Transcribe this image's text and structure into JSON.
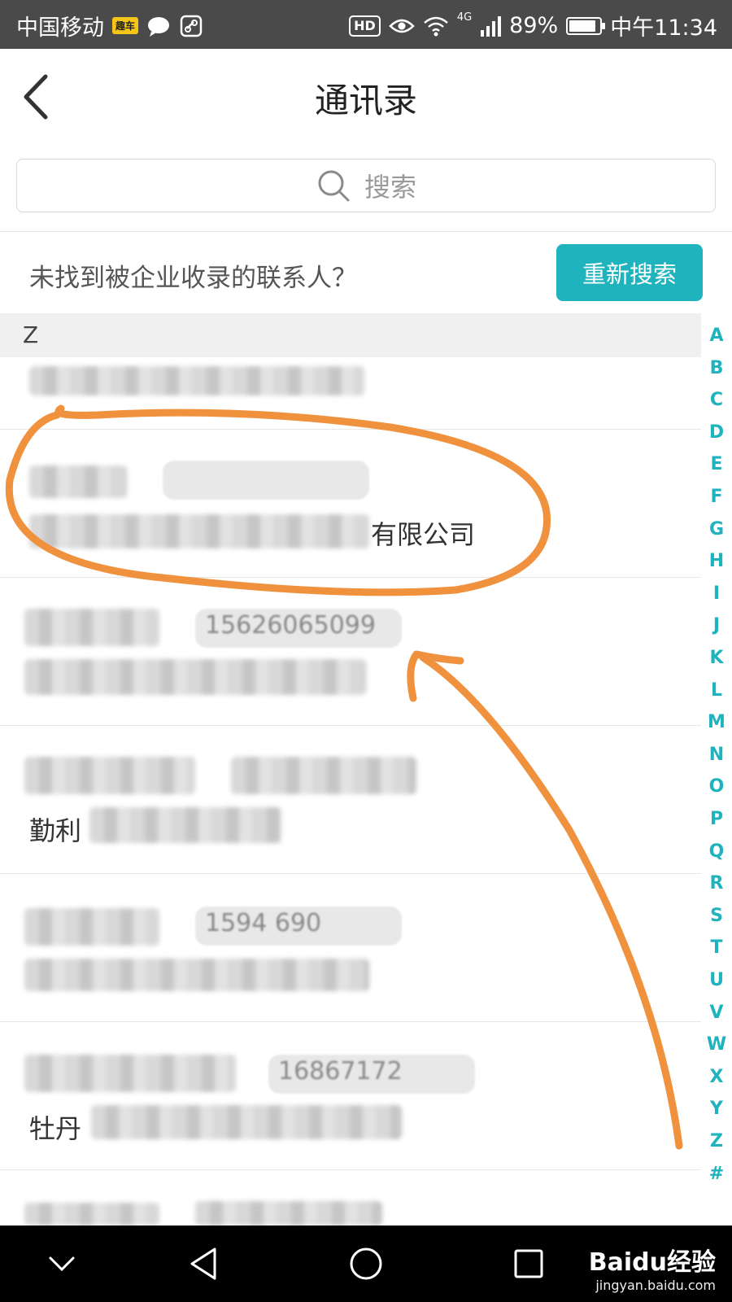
{
  "status_bar": {
    "carrier": "中国移动",
    "app_chip": "趣车",
    "network": "4G",
    "battery_percent": 89,
    "battery_text": "89%",
    "time": "中午11:34",
    "hd_label": "HD"
  },
  "header": {
    "title": "通讯录"
  },
  "search": {
    "placeholder": "搜索"
  },
  "notice": {
    "text": "未找到被企业收录的联系人？",
    "button_label": "重新搜索"
  },
  "section": {
    "letter": "Z"
  },
  "contacts": [
    {
      "name": "",
      "phone": "",
      "company": ""
    },
    {
      "name": "",
      "phone": "",
      "company": "有限公司"
    },
    {
      "name": "",
      "phone": "15626065099",
      "company": ""
    },
    {
      "name": "",
      "phone": "",
      "company": "勤利"
    },
    {
      "name": "",
      "phone": "1594      690",
      "company": ""
    },
    {
      "name": "",
      "phone": "   16867172",
      "company": "牡丹"
    },
    {
      "name": "",
      "phone": "",
      "company": ""
    }
  ],
  "alphabet_index": [
    "A",
    "B",
    "C",
    "D",
    "E",
    "F",
    "G",
    "H",
    "I",
    "J",
    "K",
    "L",
    "M",
    "N",
    "O",
    "P",
    "Q",
    "R",
    "S",
    "T",
    "U",
    "V",
    "W",
    "X",
    "Y",
    "Z",
    "#"
  ],
  "colors": {
    "accent": "#1fb3bd",
    "annotation": "#f0913e"
  },
  "watermark": {
    "brand": "Baidu经验",
    "url": "jingyan.baidu.com"
  }
}
